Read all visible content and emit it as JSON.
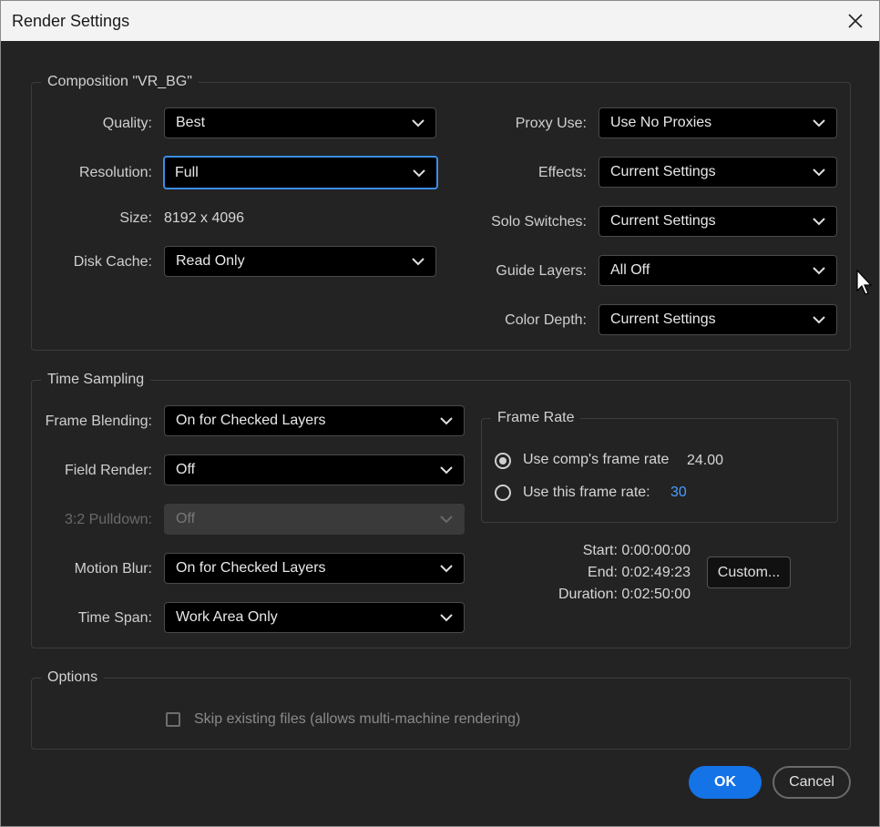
{
  "window": {
    "title": "Render Settings"
  },
  "composition": {
    "legend": "Composition \"VR_BG\"",
    "quality": {
      "label": "Quality:",
      "value": "Best"
    },
    "resolution": {
      "label": "Resolution:",
      "value": "Full"
    },
    "size": {
      "label": "Size:",
      "value": "8192 x 4096"
    },
    "disk_cache": {
      "label": "Disk Cache:",
      "value": "Read Only"
    },
    "proxy_use": {
      "label": "Proxy Use:",
      "value": "Use No Proxies"
    },
    "effects": {
      "label": "Effects:",
      "value": "Current Settings"
    },
    "solo_switches": {
      "label": "Solo Switches:",
      "value": "Current Settings"
    },
    "guide_layers": {
      "label": "Guide Layers:",
      "value": "All Off"
    },
    "color_depth": {
      "label": "Color Depth:",
      "value": "Current Settings"
    }
  },
  "time_sampling": {
    "legend": "Time Sampling",
    "frame_blending": {
      "label": "Frame Blending:",
      "value": "On for Checked Layers"
    },
    "field_render": {
      "label": "Field Render:",
      "value": "Off"
    },
    "pulldown": {
      "label": "3:2 Pulldown:",
      "value": "Off",
      "disabled": true
    },
    "motion_blur": {
      "label": "Motion Blur:",
      "value": "On for Checked Layers"
    },
    "time_span": {
      "label": "Time Span:",
      "value": "Work Area Only"
    },
    "frame_rate": {
      "legend": "Frame Rate",
      "use_comp_label": "Use comp's frame rate",
      "use_comp_value": "24.00",
      "use_this_label": "Use this frame rate:",
      "use_this_value": "30",
      "selected": "use_comp"
    },
    "start": "Start: 0:00:00:00",
    "end": "End: 0:02:49:23",
    "duration": "Duration: 0:02:50:00",
    "custom_button": "Custom..."
  },
  "options": {
    "legend": "Options",
    "skip_existing_label": "Skip existing files (allows multi-machine rendering)",
    "skip_existing_checked": false
  },
  "buttons": {
    "ok": "OK",
    "cancel": "Cancel"
  },
  "colors": {
    "accent": "#1473e6",
    "focus": "#3a8ee6",
    "link": "#4a9eff",
    "background": "#232323"
  }
}
